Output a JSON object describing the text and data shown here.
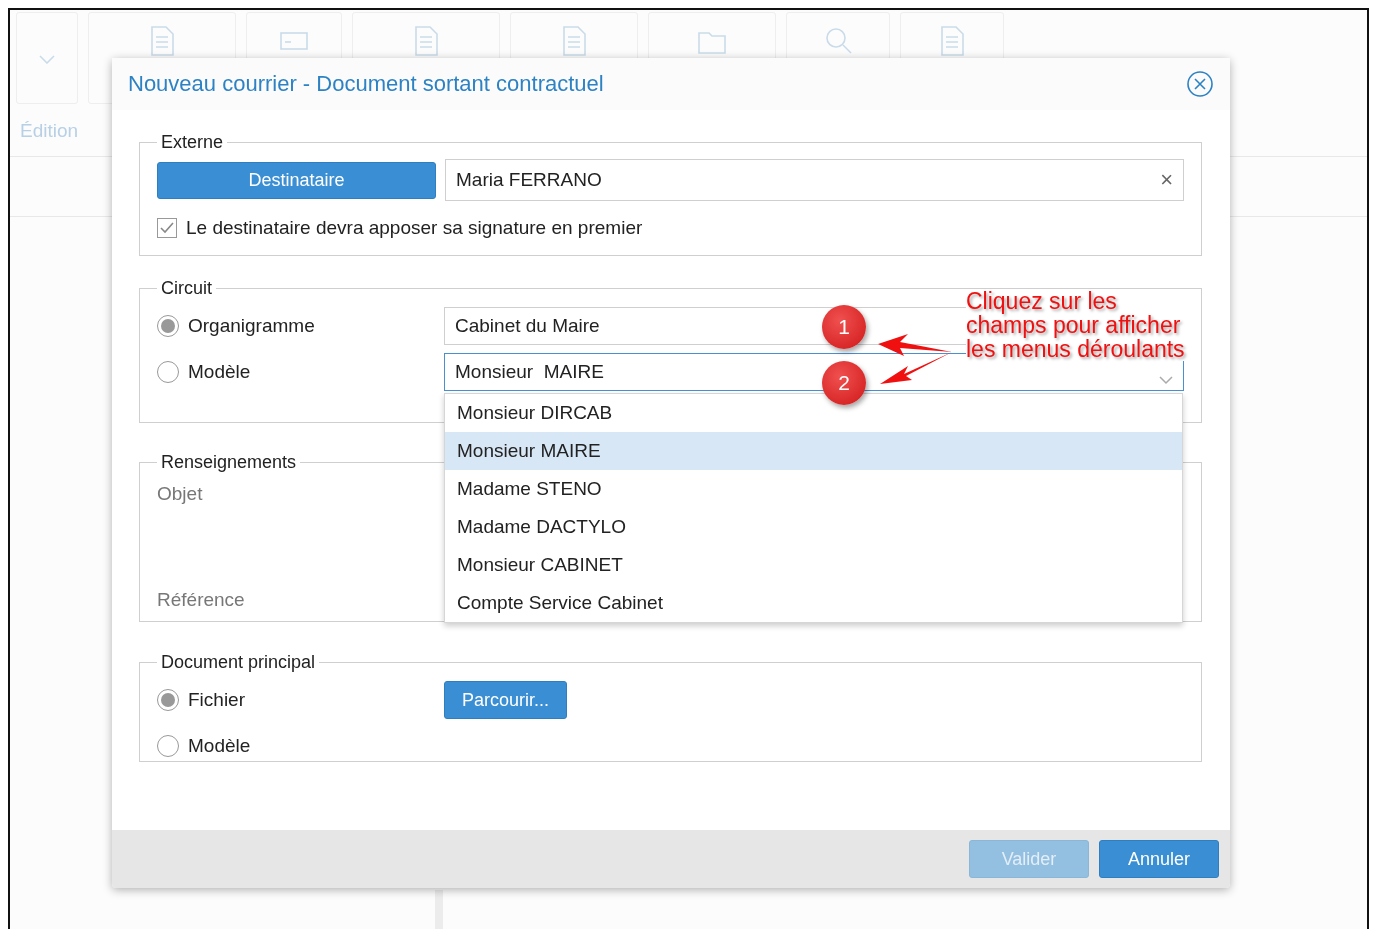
{
  "background": {
    "section_label": "Édition"
  },
  "dialog": {
    "title": "Nouveau courrier - Document sortant contractuel",
    "externe": {
      "legend": "Externe",
      "button": "Destinataire",
      "value": "Maria FERRANO",
      "clear": "×",
      "checkbox": {
        "label": "Le destinataire devra apposer sa signature en premier",
        "checked": true
      }
    },
    "circuit": {
      "legend": "Circuit",
      "options": [
        {
          "label": "Organigramme",
          "selected": true,
          "field": "Cabinet du Maire"
        },
        {
          "label": "Modèle",
          "selected": false,
          "field": "Monsieur  MAIRE"
        }
      ],
      "dropdown": [
        {
          "label": "Monsieur DIRCAB",
          "selected": false
        },
        {
          "label": "Monsieur MAIRE",
          "selected": true
        },
        {
          "label": "Madame STENO",
          "selected": false
        },
        {
          "label": "Madame DACTYLO",
          "selected": false
        },
        {
          "label": "Monsieur CABINET",
          "selected": false
        },
        {
          "label": "Compte Service Cabinet",
          "selected": false
        }
      ]
    },
    "renseignements": {
      "legend": "Renseignements",
      "labels": [
        "Objet",
        "Référence"
      ]
    },
    "document": {
      "legend": "Document principal",
      "options": [
        {
          "label": "Fichier",
          "selected": true
        },
        {
          "label": "Modèle",
          "selected": false
        }
      ],
      "browse": "Parcourir..."
    },
    "buttons": [
      {
        "label": "Valider",
        "disabled": true
      },
      {
        "label": "Annuler",
        "disabled": false
      }
    ]
  },
  "annotation": {
    "badges": [
      "1",
      "2"
    ],
    "note": "Cliquez sur les\nchamps pour afficher\nles menus déroulants"
  }
}
